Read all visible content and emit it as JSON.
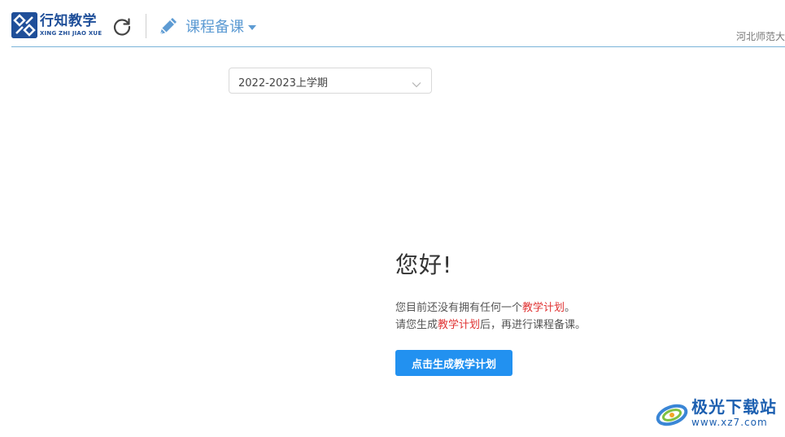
{
  "header": {
    "logo_cn": "行知教学",
    "logo_en": "XING ZHI JIAO XUE",
    "module_label": "课程备课",
    "school": "河北师范大"
  },
  "term_select": {
    "selected": "2022-2023上学期"
  },
  "welcome": {
    "hello": "您好!",
    "line1_prefix": "您目前还没有拥有任何一个",
    "line1_highlight": "教学计划",
    "line1_suffix": "。",
    "line2_prefix": "请您生成",
    "line2_highlight": "教学计划",
    "line2_suffix": "后，再进行课程备课。",
    "button_label": "点击生成教学计划"
  },
  "watermark": {
    "cn": "极光下载站",
    "url": "www.xz7.com"
  },
  "colors": {
    "brand": "#1f4f99",
    "accent": "#5d9bd3",
    "primary_button": "#2291f0",
    "highlight": "#e03333"
  },
  "icons": [
    "logo-icon",
    "refresh-icon",
    "pencil-icon",
    "caret-down-icon",
    "chevron-down-icon",
    "watermark-logo-icon"
  ]
}
